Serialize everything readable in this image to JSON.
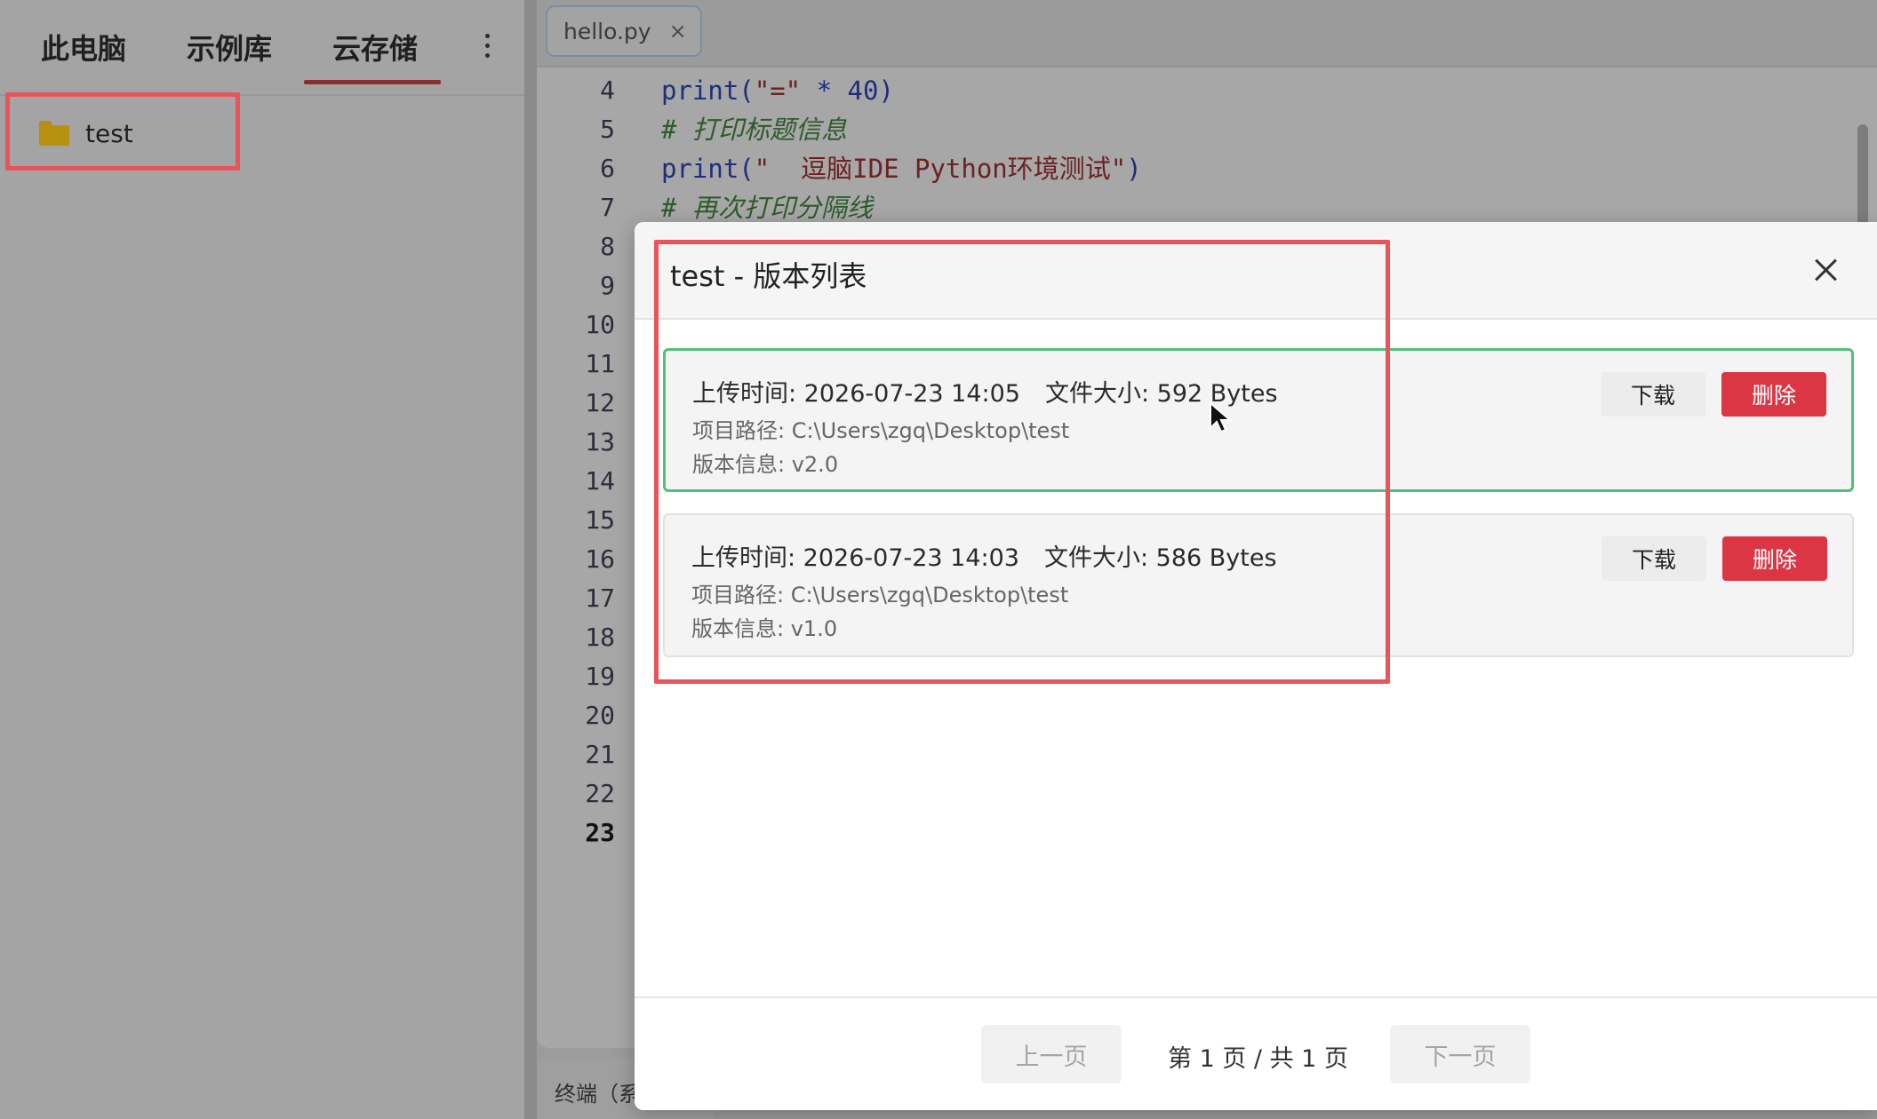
{
  "sidebar": {
    "tabs": [
      {
        "label": "此电脑"
      },
      {
        "label": "示例库"
      },
      {
        "label": "云存储"
      }
    ],
    "active_tab": "云存储",
    "tree": [
      {
        "label": "test",
        "icon": "folder-icon"
      }
    ]
  },
  "editor": {
    "open_tab": {
      "name": "hello.py",
      "close": "×"
    },
    "line_numbers": [
      "4",
      "5",
      "6",
      "7",
      "8",
      "9",
      "10",
      "11",
      "12",
      "13",
      "14",
      "15",
      "16",
      "17",
      "18",
      "19",
      "20",
      "21",
      "22",
      "23"
    ],
    "active_line": "23",
    "code": {
      "l4_kw": "print(",
      "l4_str": "\"=\"",
      "l4_rest": " * 40)",
      "l5_cmt": "# 打印标题信息",
      "l6_kw": "print(",
      "l6_str": "\"  逗脑IDE Python环境测试\"",
      "l6_rest": ")",
      "l7_cmt": "# 再次打印分隔线"
    }
  },
  "terminal": {
    "tab_label": "终端（系"
  },
  "modal": {
    "title": "test - 版本列表",
    "versions": [
      {
        "upload_time": "上传时间: 2026-07-23 14:05",
        "file_size": "文件大小: 592 Bytes",
        "path": "项目路径: C:\\Users\\zgq\\Desktop\\test",
        "version": "版本信息: v2.0"
      },
      {
        "upload_time": "上传时间: 2026-07-23 14:03",
        "file_size": "文件大小: 586 Bytes",
        "path": "项目路径: C:\\Users\\zgq\\Desktop\\test",
        "version": "版本信息: v1.0"
      }
    ],
    "download_label": "下载",
    "delete_label": "删除",
    "pagination": {
      "prev_label": "上一页",
      "next_label": "下一页",
      "page_info": "第 1 页 / 共 1 页"
    }
  },
  "colors": {
    "delete_button": "#dc3544",
    "highlight_box": "#e8545a",
    "selected_card_border": "#54bf7a",
    "active_tab_underline": "#8a2f2f"
  }
}
